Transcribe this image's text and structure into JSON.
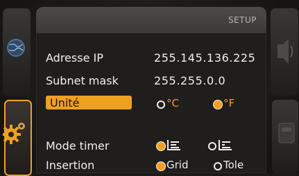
{
  "header": {
    "title": "SETUP"
  },
  "rows": {
    "ip": {
      "label": "Adresse IP",
      "value": "255.145.136.225"
    },
    "subnet": {
      "label": "Subnet mask",
      "value": "255.255.0.0"
    },
    "unit": {
      "label": "Unité",
      "options": [
        "°C",
        "°F"
      ],
      "selected": "°F"
    },
    "timer": {
      "label": "Mode timer",
      "selected_index": 0
    },
    "insertion": {
      "label": "Insertion",
      "options": [
        "Grid",
        "Tole"
      ],
      "selected": "Grid"
    }
  },
  "colors": {
    "accent": "#f0a020",
    "text": "#f2f0ea",
    "panel": "#1f1e1d"
  },
  "icons": [
    "globe-icon",
    "gear-icon",
    "timer-mode-icon"
  ]
}
